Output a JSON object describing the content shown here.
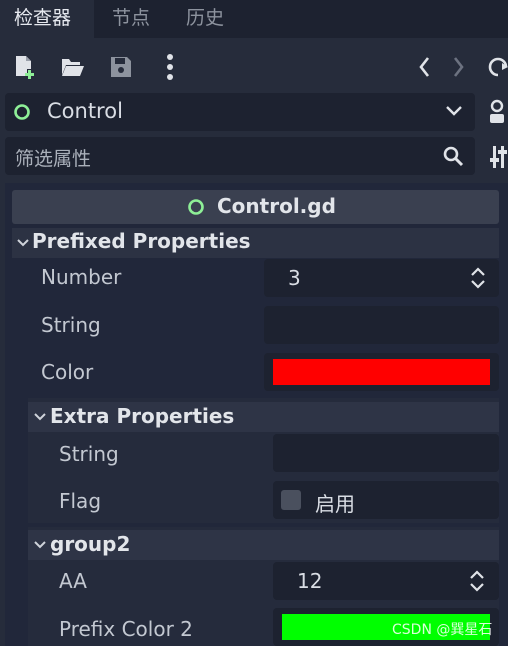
{
  "tabs": [
    {
      "label": "检查器",
      "active": true
    },
    {
      "label": "节点",
      "active": false
    },
    {
      "label": "历史",
      "active": false
    }
  ],
  "toolbar": {
    "icons": [
      "new-resource-icon",
      "open-folder-icon",
      "save-icon",
      "more-vertical-icon",
      "back-icon",
      "forward-icon",
      "history-icon"
    ]
  },
  "object_selector": {
    "value": "Control",
    "icon": "control-circle-icon"
  },
  "filter": {
    "placeholder": "筛选属性"
  },
  "script_header": {
    "label": "Control.gd"
  },
  "sections": {
    "prefixed": {
      "title": "Prefixed Properties"
    },
    "extra": {
      "title": "Extra Properties"
    },
    "group2": {
      "title": "group2"
    }
  },
  "properties": {
    "number": {
      "label": "Number",
      "value": "3"
    },
    "string": {
      "label": "String",
      "value": ""
    },
    "color": {
      "label": "Color",
      "value": "#ff0000"
    },
    "extra_string": {
      "label": "String",
      "value": ""
    },
    "flag": {
      "label": "Flag",
      "checkbox_label": "启用",
      "checked": false
    },
    "aa": {
      "label": "AA",
      "value": "12"
    },
    "prefix_color_2": {
      "label": "Prefix Color 2",
      "value": "#00ff00"
    }
  },
  "watermark": "CSDN @巽星石",
  "colors": {
    "background": "#262c3b",
    "panel": "#1d2230",
    "accent_green": "#8eef97"
  }
}
